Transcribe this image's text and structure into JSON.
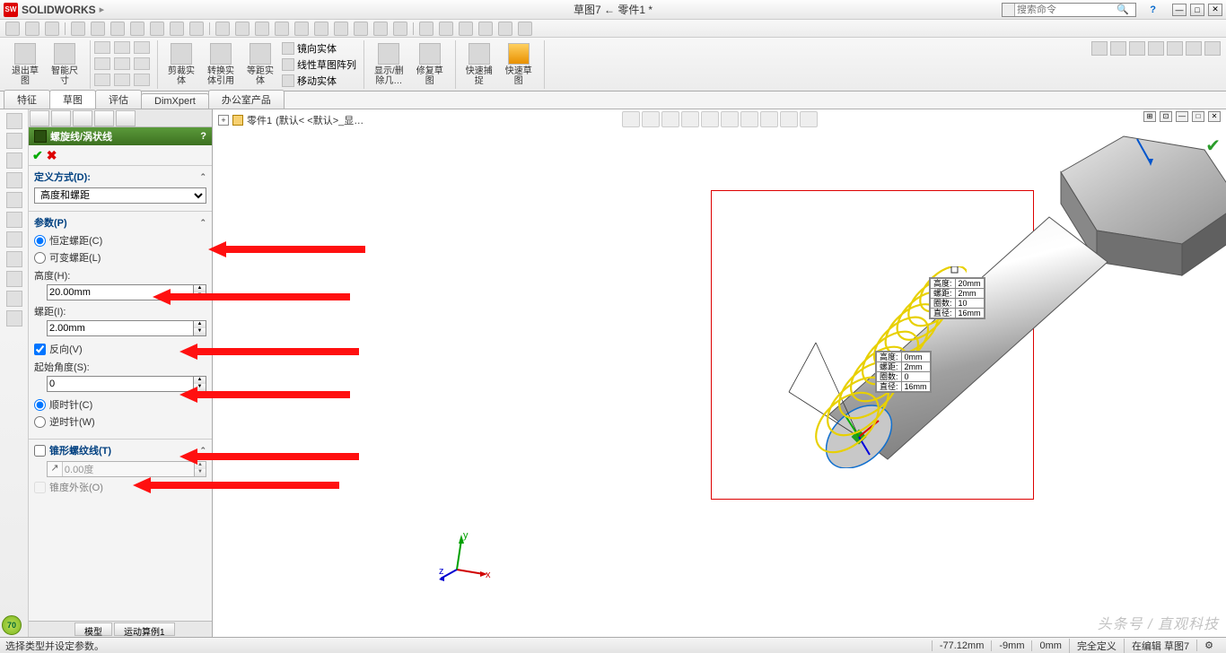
{
  "title": {
    "brand": "SOLIDWORKS",
    "doc": "草图7 ← 零件1 *"
  },
  "search": {
    "placeholder": "搜索命令"
  },
  "ribbon": {
    "exit_sketch": "退出草\n图",
    "smart_dim": "智能尺\n寸",
    "trim": "剪裁实\n体",
    "convert": "转换实\n体引用",
    "offset": "等距实\n体",
    "mirror": "镜向实体",
    "linear_pattern": "线性草图阵列",
    "move": "移动实体",
    "show_hide": "显示/删\n除几…",
    "repair": "修复草\n图",
    "quick_snap": "快速捕\n捉",
    "rapid_sketch": "快速草\n图"
  },
  "tabs": {
    "t1": "特征",
    "t2": "草图",
    "t3": "评估",
    "t4": "DimXpert",
    "t5": "办公室产品"
  },
  "breadcrumb": {
    "part": "零件1",
    "config": "(默认< <默认>_显…"
  },
  "panel": {
    "title": "螺旋线/涡状线",
    "def_method": {
      "label": "定义方式(D):",
      "value": "高度和螺距"
    },
    "params": {
      "label": "参数(P)",
      "const_pitch": "恒定螺距(C)",
      "var_pitch": "可变螺距(L)",
      "height_lbl": "高度(H):",
      "height_val": "20.00mm",
      "pitch_lbl": "螺距(I):",
      "pitch_val": "2.00mm",
      "reverse": "反向(V)",
      "start_angle_lbl": "起始角度(S):",
      "start_angle_val": "0",
      "cw": "顺时针(C)",
      "ccw": "逆时针(W)"
    },
    "taper": {
      "label": "锥形螺纹线(T)",
      "val": "0.00度",
      "outward": "锥度外张(O)"
    },
    "btab1": "模型",
    "btab2": "运动算例1"
  },
  "callout_top": {
    "r1k": "高度:",
    "r1v": "20mm",
    "r2k": "螺距:",
    "r2v": "2mm",
    "r3k": "圈数:",
    "r3v": "10",
    "r4k": "直径:",
    "r4v": "16mm"
  },
  "callout_bot": {
    "r1k": "高度:",
    "r1v": "0mm",
    "r2k": "螺距:",
    "r2v": "2mm",
    "r3k": "圈数:",
    "r3v": "0",
    "r4k": "直径:",
    "r4v": "16mm"
  },
  "status": {
    "hint": "选择类型并设定参数。",
    "x": "-77.12mm",
    "y": "-9mm",
    "z": "0mm",
    "defined": "完全定义",
    "edit": "在编辑 草图7"
  },
  "watermark": "头条号 / 直观科技",
  "badge": "70",
  "axes": {
    "x": "x",
    "y": "y",
    "z": "z"
  }
}
